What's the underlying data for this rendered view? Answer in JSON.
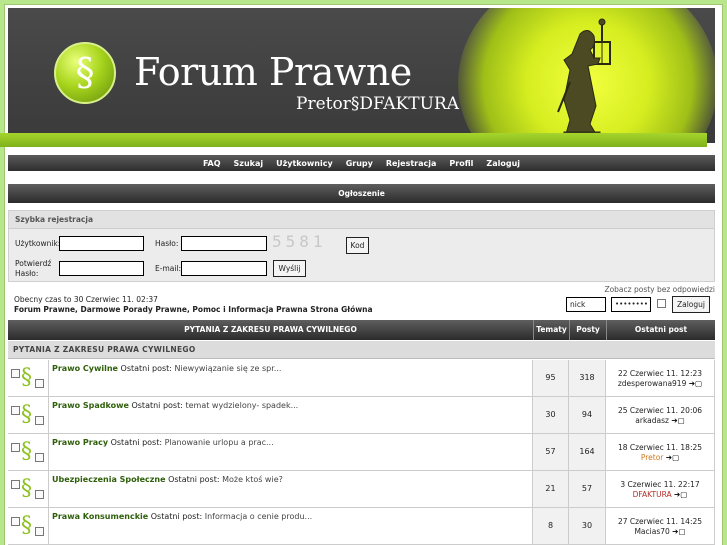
{
  "header": {
    "title": "Forum Prawne",
    "subtitle": "Pretor§DFAKTURA",
    "logo_icon": "section-sign-logo",
    "accent": "#a5d52c"
  },
  "nav": [
    "FAQ",
    "Szukaj",
    "Użytkownicy",
    "Grupy",
    "Rejestracja",
    "Profil",
    "Zaloguj"
  ],
  "announcement": "Ogłoszenie",
  "quick_reg": {
    "title": "Szybka rejestracja",
    "user_label": "Użytkownik:",
    "pass_label": "Hasło:",
    "captcha": "5581",
    "code_btn": "Kod",
    "confirm_label": "Potwierdź Hasło:",
    "email_label": "E-mail:",
    "submit_btn": "Wyślij"
  },
  "unanswered": "Zobacz posty bez odpowiedzi",
  "time": "Obecny czas to 30 Czerwiec 11. 02:37",
  "breadcrumb": "Forum Prawne, Darmowe Porady Prawne, Pomoc i Informacja Prawna Strona Główna",
  "login": {
    "user_value": "nick",
    "pass_value": "••••••••",
    "button": "Zaloguj"
  },
  "table_headers": {
    "forum": "PYTANIA Z ZAKRESU PRAWA CYWILNEGO",
    "topics": "Tematy",
    "posts": "Posty",
    "last": "Ostatni post"
  },
  "category": "PYTANIA Z ZAKRESU PRAWA CYWILNEGO",
  "forums": [
    {
      "name": "Prawo Cywilne",
      "lp_label": "Ostatni post:",
      "lp_title": "Niewywiązanie się ze spr...",
      "topics": "95",
      "posts": "318",
      "date": "22 Czerwiec 11. 12:23",
      "user": "zdesperowana919",
      "user_color": "#222"
    },
    {
      "name": "Prawo Spadkowe",
      "lp_label": "Ostatni post:",
      "lp_title": "temat wydzielony- spadek...",
      "topics": "30",
      "posts": "94",
      "date": "25 Czerwiec 11. 20:06",
      "user": "arkadasz",
      "user_color": "#222"
    },
    {
      "name": "Prawo Pracy",
      "lp_label": "Ostatni post:",
      "lp_title": "Planowanie urlopu a prac...",
      "topics": "57",
      "posts": "164",
      "date": "18 Czerwiec 11. 18:25",
      "user": "Pretor",
      "user_color": "#d07a1a"
    },
    {
      "name": "Ubezpieczenia Społeczne",
      "lp_label": "Ostatni post:",
      "lp_title": "Może ktoś wie?",
      "topics": "21",
      "posts": "57",
      "date": "3 Czerwiec 11. 22:17",
      "user": "DFAKTURA",
      "user_color": "#b0302a"
    },
    {
      "name": "Prawa Konsumenckie",
      "lp_label": "Ostatni post:",
      "lp_title": "Informacja o cenie produ...",
      "topics": "8",
      "posts": "30",
      "date": "27 Czerwiec 11. 14:25",
      "user": "Macias70",
      "user_color": "#222"
    }
  ]
}
